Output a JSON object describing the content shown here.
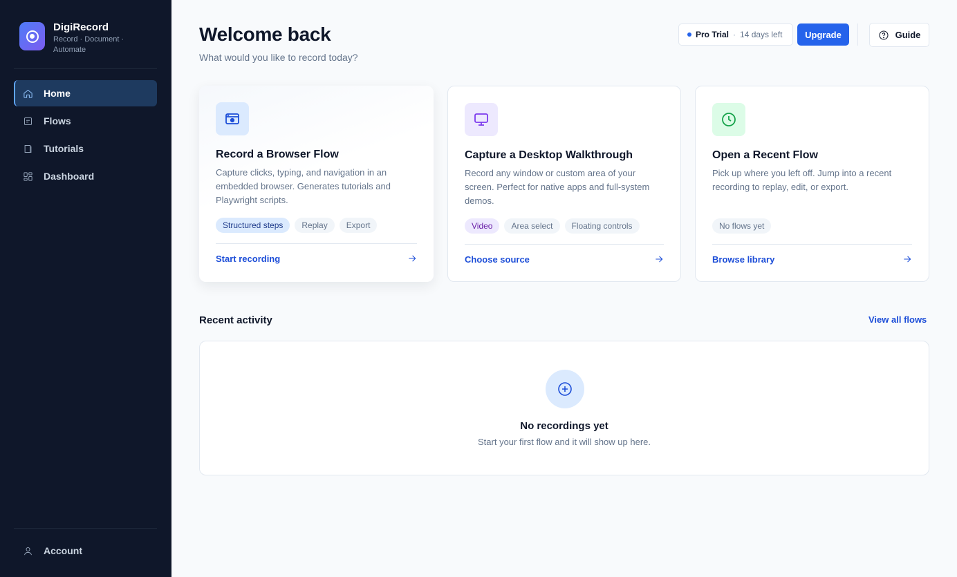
{
  "brand": {
    "name": "DigiRecord",
    "tagline": "Record · Document · Automate"
  },
  "sidebar": {
    "items": [
      {
        "label": "Home",
        "icon": "home-icon",
        "active": true
      },
      {
        "label": "Flows",
        "icon": "list-icon",
        "active": false
      },
      {
        "label": "Tutorials",
        "icon": "book-icon",
        "active": false
      },
      {
        "label": "Dashboard",
        "icon": "grid-icon",
        "active": false
      }
    ],
    "account_label": "Account"
  },
  "header": {
    "title": "Welcome back",
    "subtitle": "What would you like to record today?",
    "trial_plan": "Pro Trial",
    "trial_sep": "·",
    "trial_days": "14 days left",
    "upgrade_label": "Upgrade",
    "guide_label": "Guide"
  },
  "cards": [
    {
      "title": "Record a Browser Flow",
      "description": "Capture clicks, typing, and navigation in an embedded browser. Generates tutorials and Playwright scripts.",
      "chips": [
        "Structured steps",
        "Replay",
        "Export"
      ],
      "action": "Start recording",
      "icon": "browser-icon",
      "accent": "#2563eb"
    },
    {
      "title": "Capture a Desktop Walkthrough",
      "description": "Record any window or custom area of your screen. Perfect for native apps and full-system demos.",
      "chips": [
        "Video",
        "Area select",
        "Floating controls"
      ],
      "action": "Choose source",
      "icon": "monitor-icon",
      "accent": "#7c3aed"
    },
    {
      "title": "Open a Recent Flow",
      "description": "Pick up where you left off. Jump into a recent recording to replay, edit, or export.",
      "chips": [
        "No flows yet"
      ],
      "action": "Browse library",
      "icon": "clock-icon",
      "accent": "#16a34a"
    }
  ],
  "recent": {
    "title": "Recent activity",
    "view_all": "View all flows",
    "empty_title": "No recordings yet",
    "empty_subtitle": "Start your first flow and it will show up here."
  },
  "colors": {
    "sidebar_bg": "#0f172a",
    "primary": "#2563eb",
    "link": "#1d4ed8"
  }
}
